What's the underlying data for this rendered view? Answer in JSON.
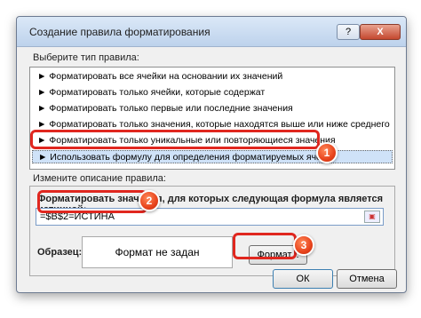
{
  "dialog": {
    "title": "Создание правила форматирования",
    "help_label": "?",
    "close_label": "X"
  },
  "rule_type": {
    "label": "Выберите тип правила:",
    "items": [
      {
        "label": "► Форматировать все ячейки на основании их значений"
      },
      {
        "label": "► Форматировать только ячейки, которые содержат"
      },
      {
        "label": "► Форматировать только первые или последние значения"
      },
      {
        "label": "► Форматировать только значения, которые находятся выше или ниже среднего"
      },
      {
        "label": "► Форматировать только уникальные или повторяющиеся значения"
      },
      {
        "label": "► Использовать формулу для определения форматируемых ячеек"
      }
    ],
    "selected_index": 5
  },
  "description": {
    "label": "Измените описание правила:",
    "formula_label": "Форматировать значения, для которых следующая формула является истинной:",
    "formula_value": "=$B$2=ИСТИНА",
    "sample_label": "Образец:",
    "sample_text": "Формат не задан",
    "format_button": "Формат..."
  },
  "buttons": {
    "ok": "ОК",
    "cancel": "Отмена"
  },
  "annotations": {
    "badge1": "1",
    "badge2": "2",
    "badge3": "3",
    "color": "#e0271f"
  }
}
